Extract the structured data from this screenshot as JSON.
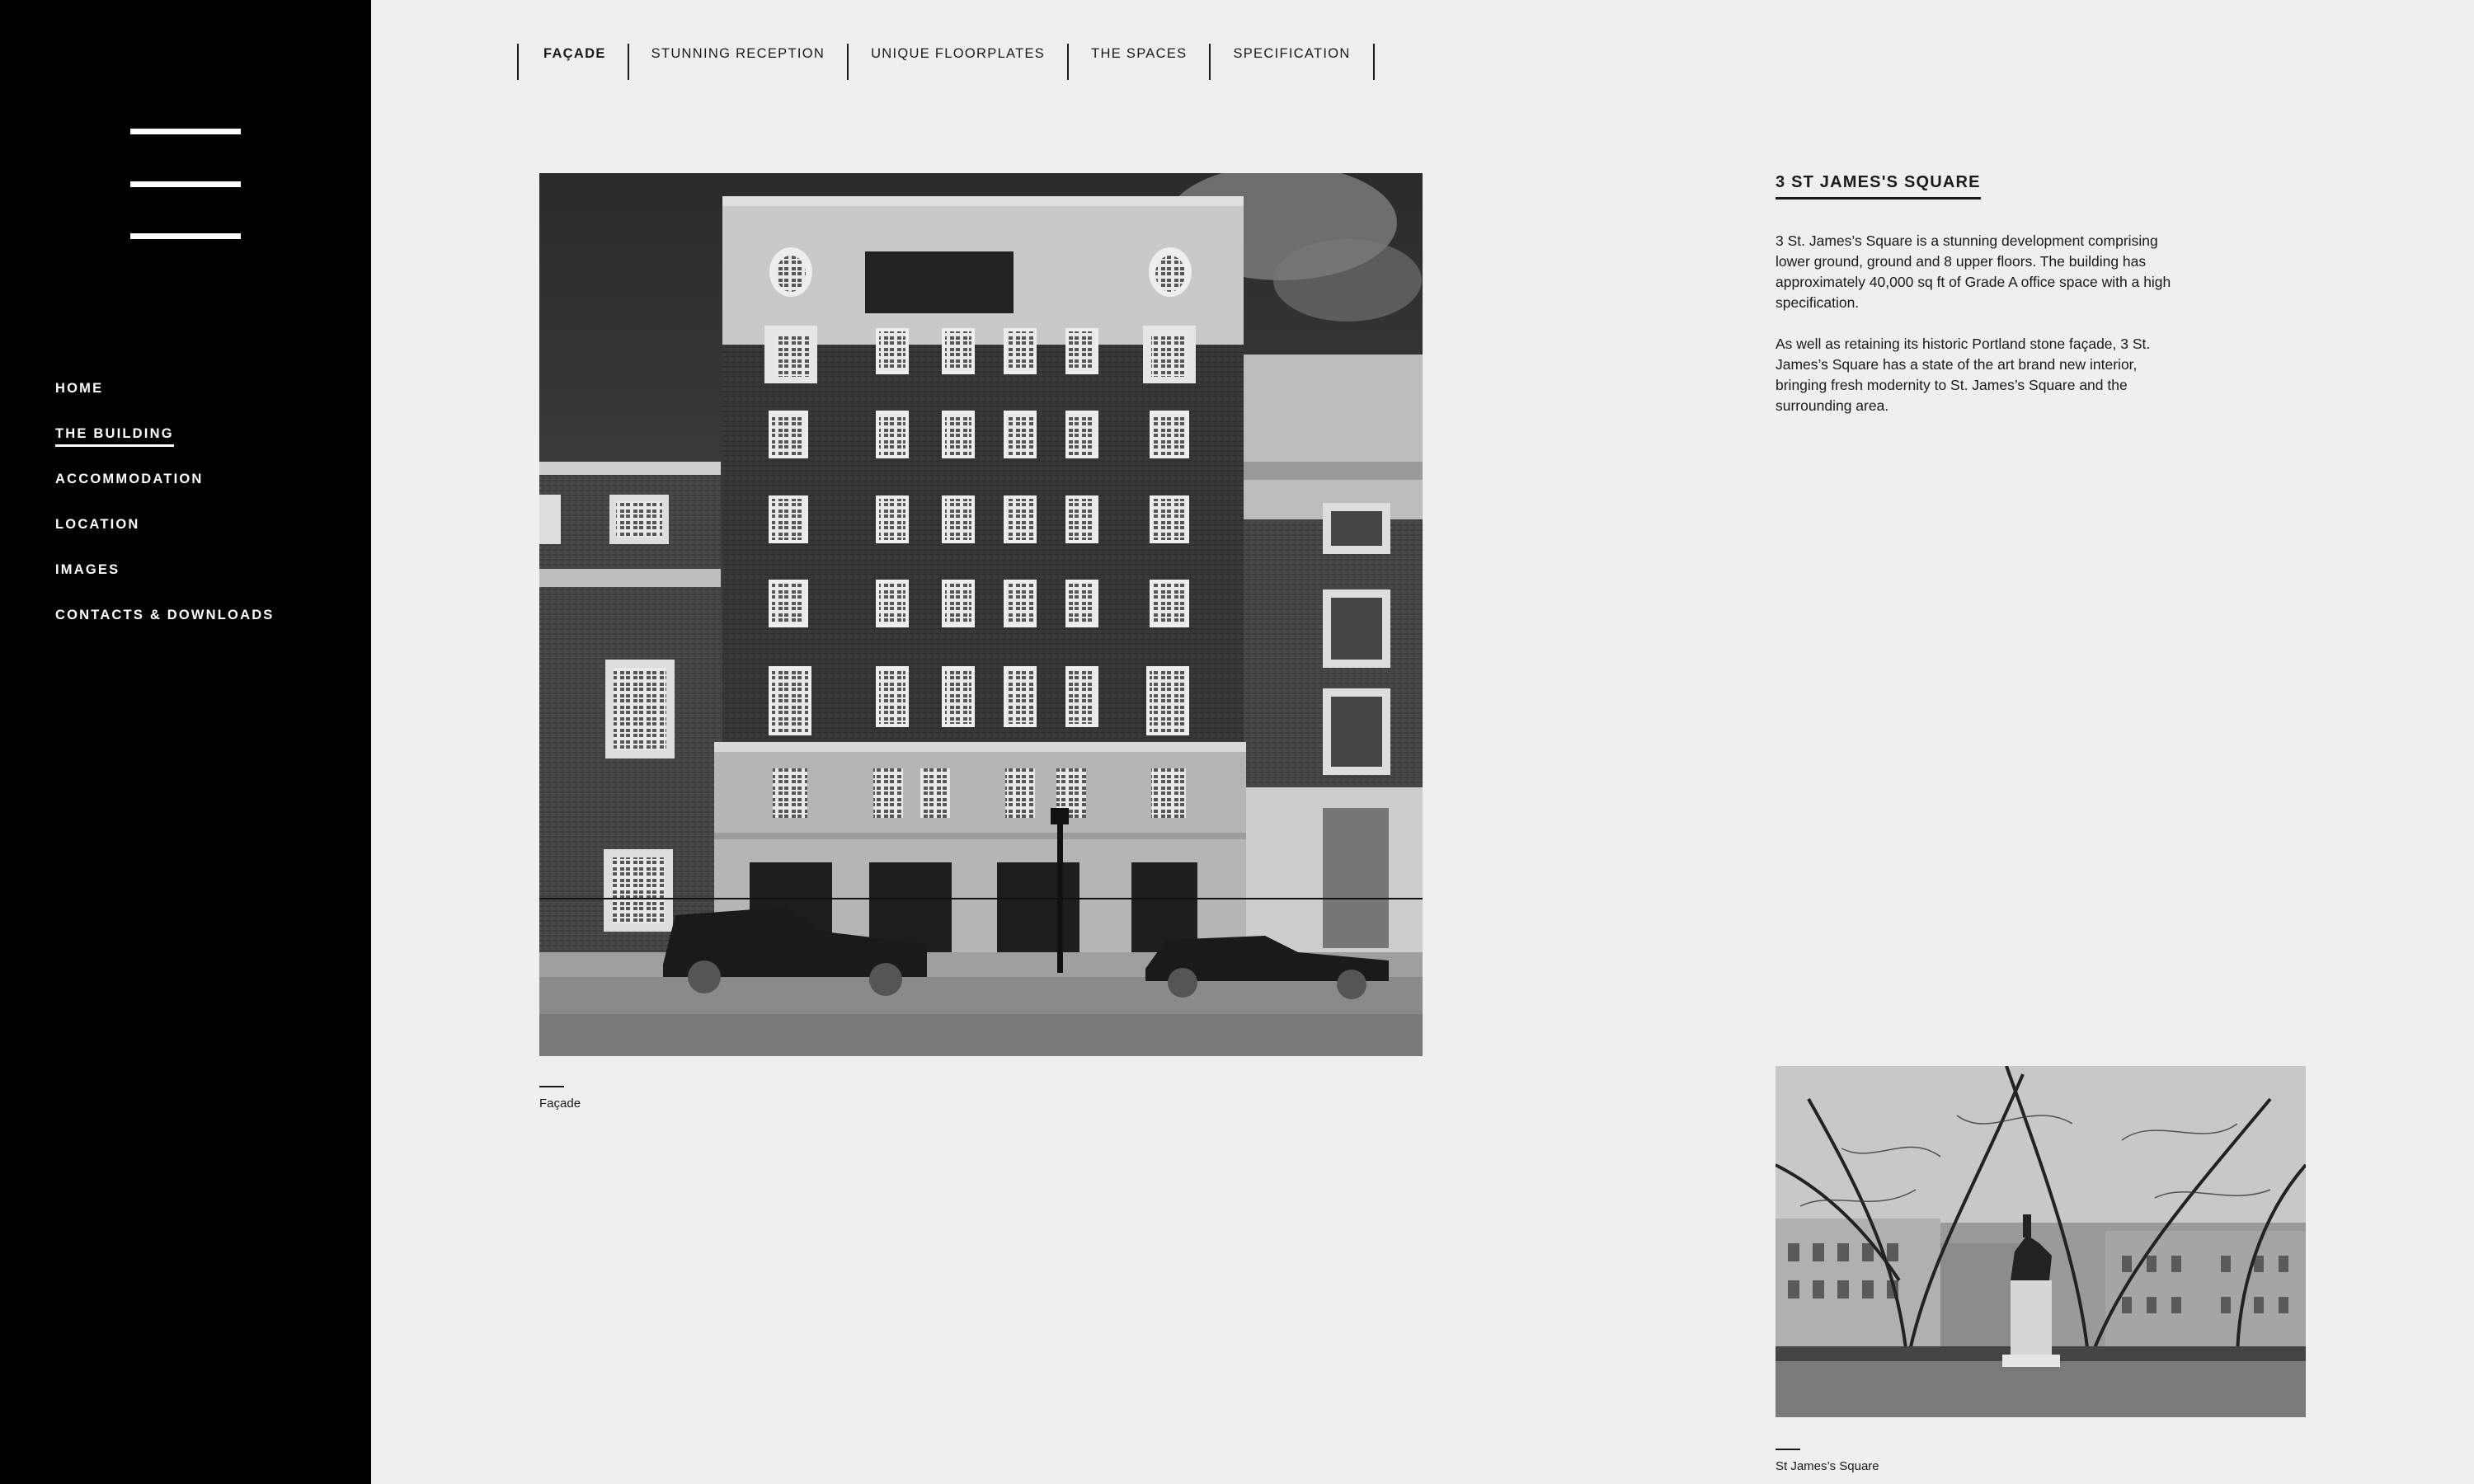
{
  "sidebar": {
    "menu_icon": "hamburger-menu-icon",
    "items": [
      {
        "label": "HOME"
      },
      {
        "label": "THE BUILDING",
        "active": true
      },
      {
        "label": "ACCOMMODATION"
      },
      {
        "label": "LOCATION"
      },
      {
        "label": "IMAGES"
      },
      {
        "label": "CONTACTS & DOWNLOADS"
      }
    ]
  },
  "tabs": [
    {
      "label": "FAÇADE",
      "active": true
    },
    {
      "label": "STUNNING RECEPTION"
    },
    {
      "label": "UNIQUE FLOORPLATES"
    },
    {
      "label": "THE SPACES"
    },
    {
      "label": "SPECIFICATION"
    }
  ],
  "main_image": {
    "caption": "Façade"
  },
  "content": {
    "title": "3 ST JAMES'S SQUARE",
    "paragraphs": [
      "3 St. James’s Square is a stunning development comprising lower ground, ground and 8 upper floors. The building has approximately 40,000 sq ft of Grade A office space with a high specification.",
      "As well as retaining its historic Portland stone façade, 3 St. James’s Square has a state of the art brand new interior, bringing fresh modernity to St. James’s Square and the surrounding area."
    ]
  },
  "second_image": {
    "caption": "St James’s Square"
  },
  "colors": {
    "sidebar_bg": "#000000",
    "page_bg": "#efefef",
    "text": "#1a1a1a"
  }
}
